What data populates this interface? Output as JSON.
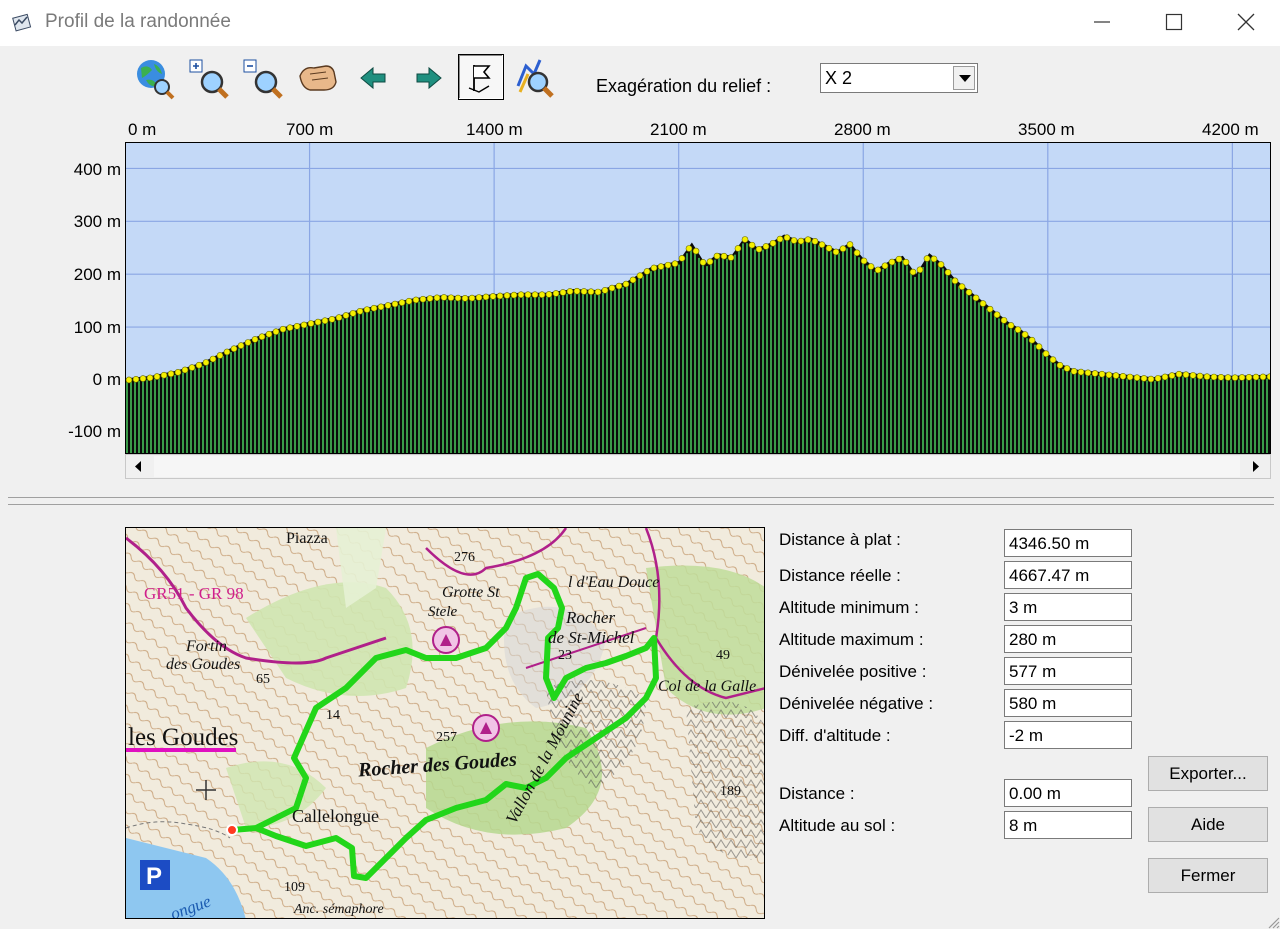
{
  "window": {
    "title": "Profil de la randonnée",
    "icons": {
      "app": "profile-app-icon",
      "minimize": "minimize-icon",
      "maximize": "maximize-icon",
      "close": "close-icon"
    }
  },
  "toolbar": {
    "buttons": [
      {
        "name": "zoom-full-view",
        "icon": "globe-magnifier-icon"
      },
      {
        "name": "zoom-in",
        "icon": "zoom-in-icon"
      },
      {
        "name": "zoom-out",
        "icon": "zoom-out-icon"
      },
      {
        "name": "pan",
        "icon": "hand-icon"
      },
      {
        "name": "previous",
        "icon": "arrow-left-icon"
      },
      {
        "name": "next",
        "icon": "arrow-right-icon"
      },
      {
        "name": "show-waypoints",
        "icon": "flag-icon",
        "pressed": true
      },
      {
        "name": "zoom-route",
        "icon": "route-magnifier-icon"
      }
    ],
    "exaggeration_label": "Exagération du relief :",
    "exaggeration_value": "X 2"
  },
  "chart_data": {
    "type": "area",
    "title": "",
    "xlabel": "",
    "ylabel": "",
    "x_ticks": [
      "0 m",
      "700 m",
      "1400 m",
      "2100 m",
      "2800 m",
      "3500 m",
      "4200 m"
    ],
    "y_ticks": [
      "400 m",
      "300 m",
      "200 m",
      "100 m",
      "0 m",
      "-100 m"
    ],
    "xlim": [
      0,
      4346.5
    ],
    "ylim": [
      -140,
      450
    ],
    "grid": true,
    "series": [
      {
        "x": [
          0,
          100,
          200,
          300,
          400,
          500,
          600,
          700,
          800,
          900,
          1000,
          1100,
          1200,
          1300,
          1400,
          1500,
          1600,
          1700,
          1800,
          1850,
          1900,
          1950,
          2000,
          2050,
          2100,
          2150,
          2200,
          2250,
          2300,
          2350,
          2400,
          2450,
          2500,
          2550,
          2600,
          2650,
          2700,
          2750,
          2800,
          2850,
          2900,
          2950,
          3000,
          3050,
          3100,
          3150,
          3200,
          3250,
          3300,
          3350,
          3400,
          3450,
          3500,
          3550,
          3600,
          3700,
          3800,
          3900,
          4000,
          4100,
          4200,
          4346.5
        ],
        "y": [
          3,
          8,
          18,
          35,
          60,
          82,
          100,
          110,
          120,
          135,
          145,
          155,
          160,
          158,
          162,
          165,
          165,
          172,
          170,
          178,
          185,
          200,
          215,
          220,
          225,
          260,
          220,
          240,
          235,
          270,
          250,
          260,
          275,
          265,
          270,
          258,
          245,
          260,
          230,
          210,
          225,
          235,
          200,
          240,
          220,
          190,
          170,
          150,
          130,
          110,
          95,
          75,
          50,
          30,
          20,
          15,
          10,
          5,
          15,
          10,
          8,
          10
        ]
      }
    ]
  },
  "map": {
    "labels": [
      "Piazza",
      "GR51 - GR 98",
      "Fortin",
      "des Goudes",
      "276",
      "Grotte St",
      "Stele",
      "l d'Eau Douce",
      "Rocher",
      "de St-Michel",
      "23",
      "49",
      "Col de la Galle",
      "65",
      "14",
      "257",
      "les Goudes",
      "Rocher des Goudes",
      "Callelongue",
      "189",
      "109",
      "Anc. sémaphore",
      "Vallon de la Mounine",
      "ongue"
    ],
    "parking_symbol": "P"
  },
  "stats": [
    {
      "label": "Distance à plat :",
      "value": "4346.50 m"
    },
    {
      "label": "Distance réelle :",
      "value": "4667.47 m"
    },
    {
      "label": "Altitude minimum :",
      "value": "3 m"
    },
    {
      "label": "Altitude maximum :",
      "value": "280 m"
    },
    {
      "label": "Dénivelée positive :",
      "value": "577 m"
    },
    {
      "label": "Dénivelée négative :",
      "value": "580 m"
    },
    {
      "label": "Diff. d'altitude :",
      "value": "-2 m"
    }
  ],
  "cursor": [
    {
      "label": "Distance :",
      "value": "0.00 m"
    },
    {
      "label": "Altitude au sol :",
      "value": "8 m"
    }
  ],
  "buttons": {
    "export": "Exporter...",
    "help": "Aide",
    "close": "Fermer"
  },
  "colors": {
    "sky": "#c4d9f7",
    "grid": "#8aa6e4",
    "terrain_fill": "#0a0a0a",
    "terrain_hatch": "#3a9a48",
    "waypoint": "#f5f000",
    "route": "#26d31a"
  }
}
